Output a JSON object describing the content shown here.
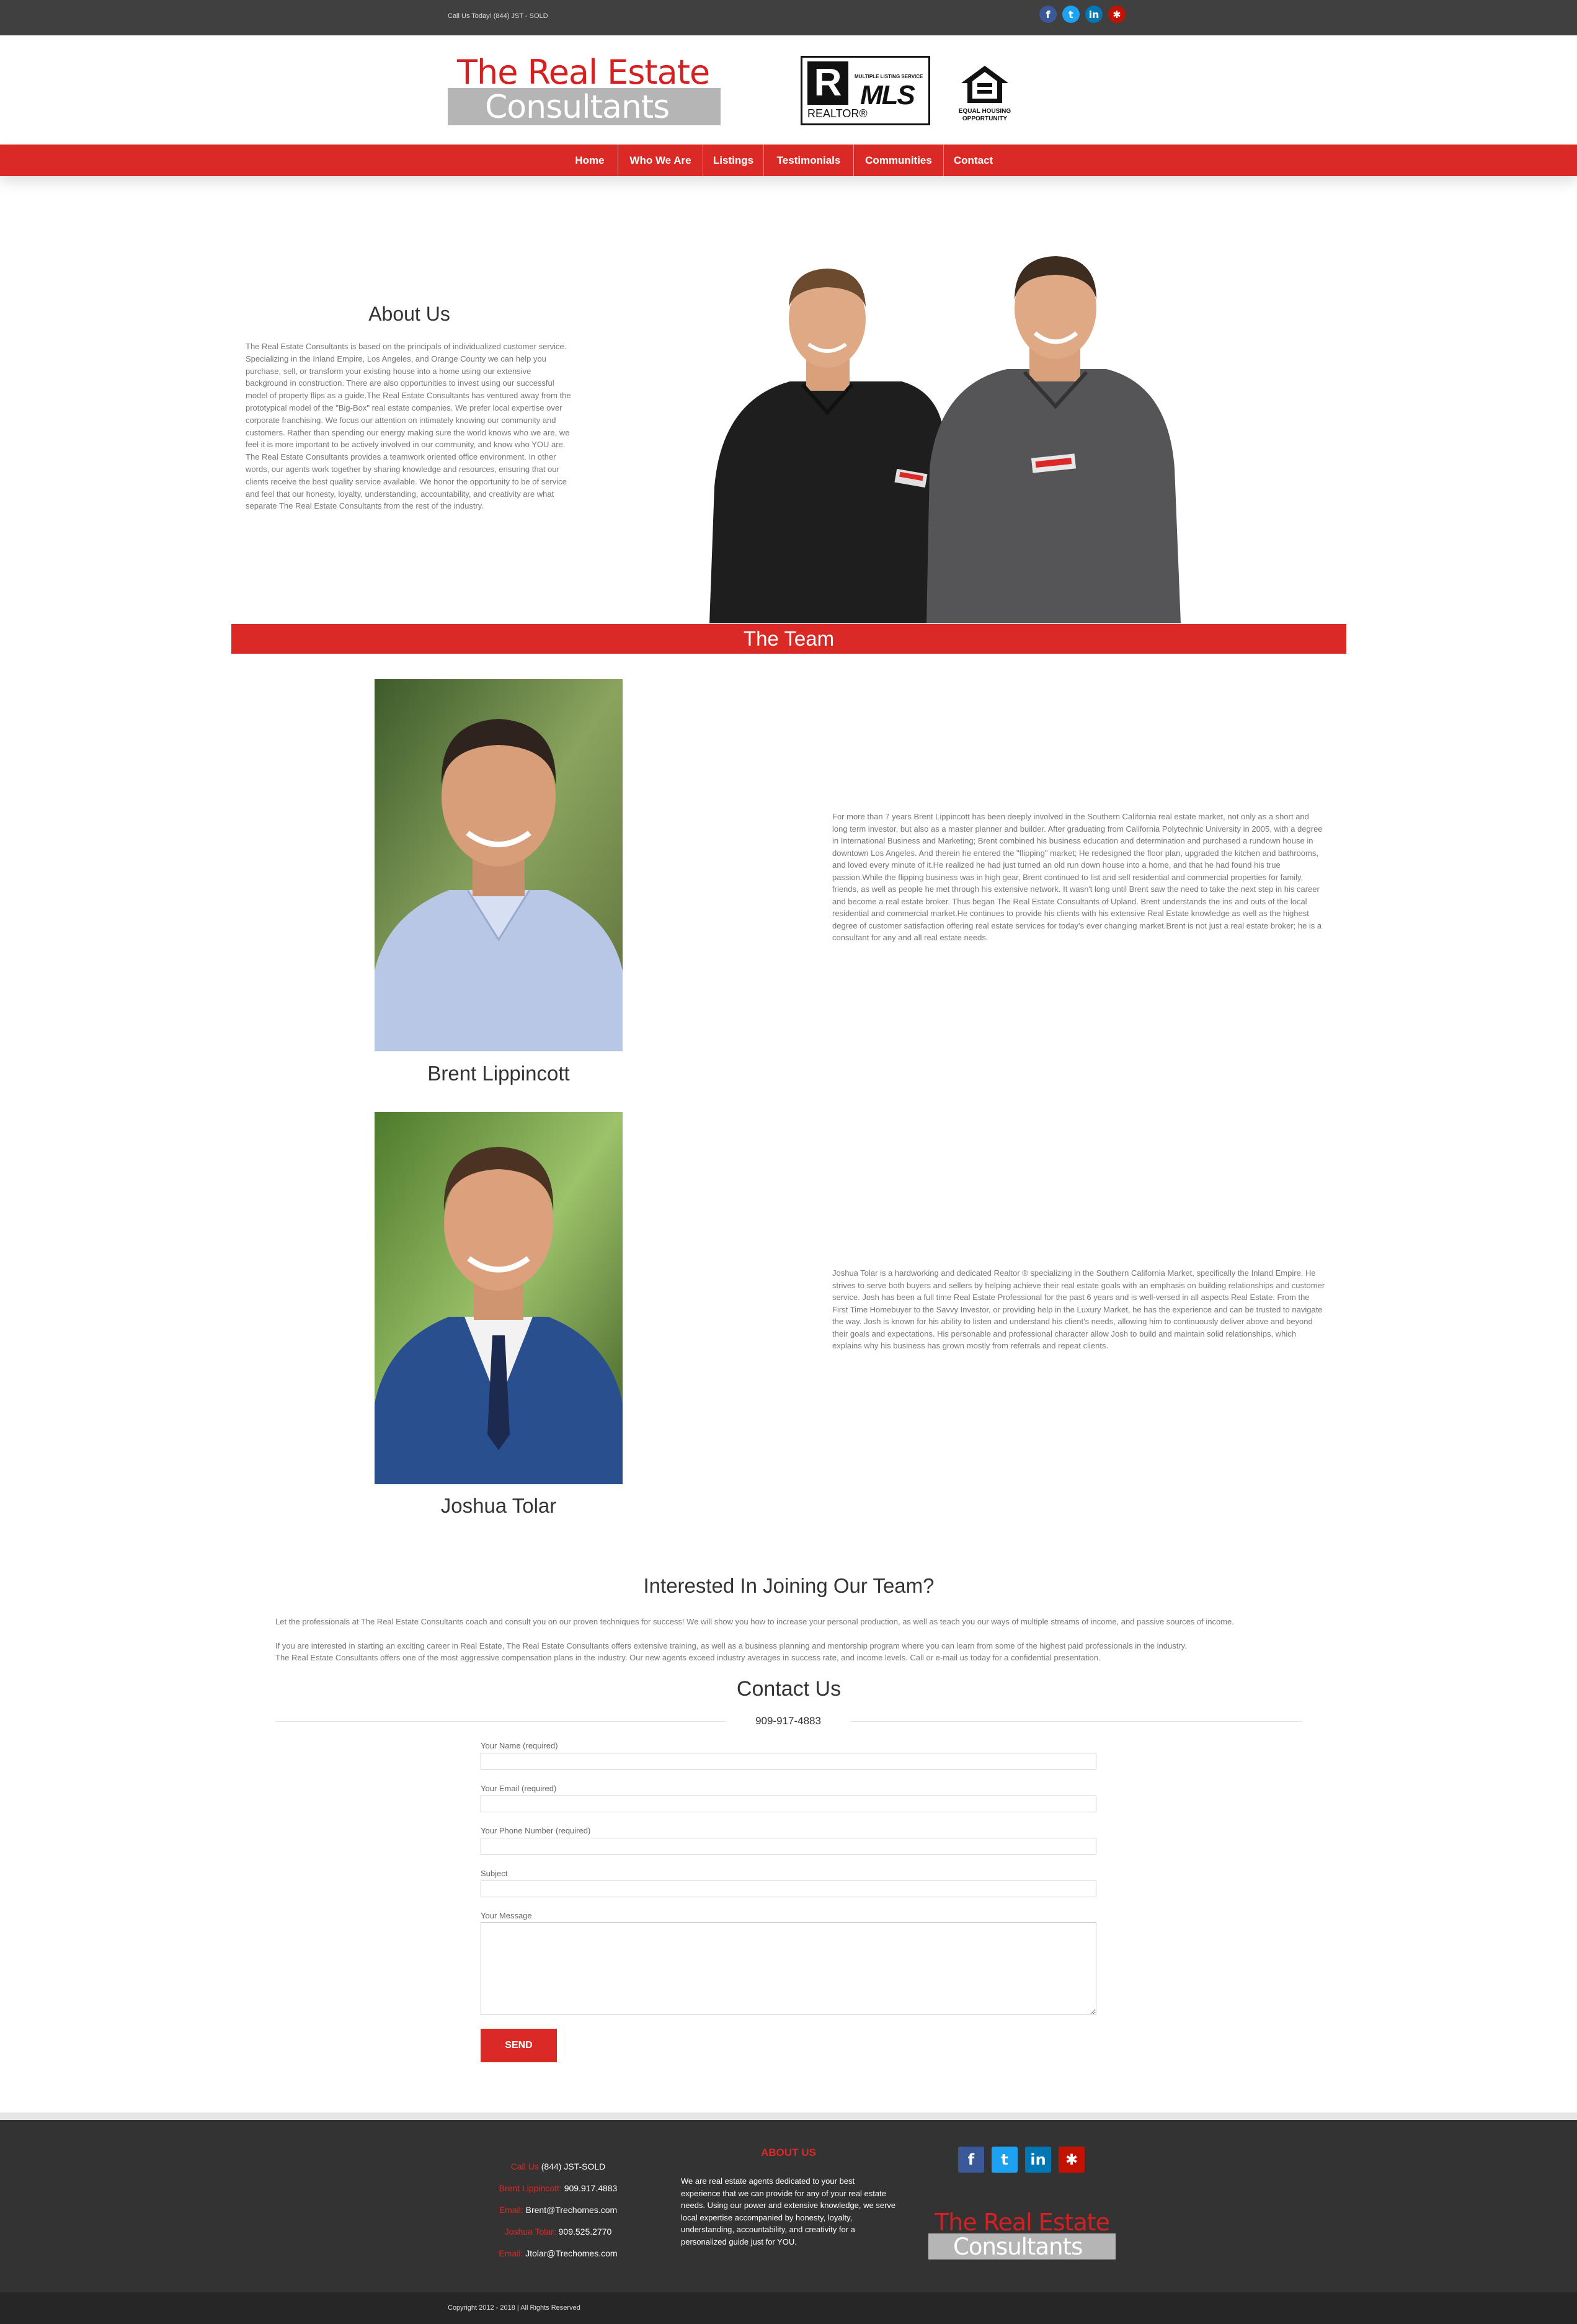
{
  "topbar": {
    "call_text": "Call Us Today! (844) JST - SOLD"
  },
  "social": [
    "facebook",
    "twitter",
    "linkedin",
    "yelp"
  ],
  "social_glyphs": {
    "facebook": "f",
    "twitter": "t",
    "linkedin": "in",
    "yelp": "✱"
  },
  "logo": {
    "line1": "The Real Estate",
    "line2": "Consultants"
  },
  "realtor_logo": {
    "letter": "R",
    "realtor": "REALTOR®",
    "mls_small": "MULTIPLE LISTING SERVICE",
    "mls": "MLS"
  },
  "eho_logo": {
    "line1": "EQUAL HOUSING",
    "line2": "OPPORTUNITY"
  },
  "nav": {
    "items": [
      {
        "label": "Home"
      },
      {
        "label": "Who We Are"
      },
      {
        "label": "Listings"
      },
      {
        "label": "Testimonials"
      },
      {
        "label": "Communities"
      },
      {
        "label": "Contact"
      }
    ]
  },
  "about": {
    "title": "About Us",
    "text": "The Real Estate Consultants is based on the principals of individualized customer service. Specializing in the Inland Empire, Los Angeles, and Orange County we can help you purchase, sell, or transform your existing house into a home using our extensive background in construction. There are also opportunities to invest using our successful model of property flips as a guide.The Real Estate Consultants has ventured away from the prototypical model of the \"Big-Box\" real estate companies. We prefer local expertise over corporate franchising. We focus our attention on intimately knowing our community and customers. Rather than spending our energy making sure the world knows who we are, we feel it is more important to be actively involved in our community, and know who YOU are. The Real Estate Consultants provides a teamwork oriented office environment. In other words, our agents work together by sharing knowledge and resources, ensuring that our clients receive the best quality service available. We honor the opportunity to be of service and feel that our honesty, loyalty, understanding, accountability, and creativity are what separate The Real Estate Consultants from the rest of the industry."
  },
  "team": {
    "banner": "The Team",
    "members": [
      {
        "name": "Brent Lippincott",
        "bio": "For more than 7 years Brent Lippincott has been deeply involved in the Southern California real estate market, not only as a short and long term investor, but also as a master planner and builder. After graduating from California Polytechnic University in 2005, with a degree in International Business and Marketing; Brent combined his business education and determination and purchased a rundown house in downtown Los Angeles. And therein he entered the \"flipping\" market; He redesigned the floor plan, upgraded the kitchen and bathrooms, and loved every minute of it.He realized he had just turned an old run down house into a home, and that he had found his true passion.While the flipping business was in high gear, Brent continued to list and sell residential and commercial properties for family, friends, as well as people he met through his extensive network. It wasn't long until Brent saw the need to take the next step in his career and become a real estate broker. Thus began The Real Estate Consultants of Upland. Brent understands the ins and outs of the local residential and commercial market.He continues to provide his clients with his extensive Real Estate knowledge as well as the highest degree of customer satisfaction offering real estate services for today's ever changing market.Brent is not just a real estate broker; he is a consultant for any and all real estate needs."
      },
      {
        "name": "Joshua Tolar",
        "bio": "Joshua Tolar is a hardworking and dedicated Realtor ® specializing in the Southern California Market, specifically the Inland Empire. He strives to serve both buyers and sellers by helping achieve their real estate goals with an emphasis on building relationships and customer service. Josh has been a full time Real Estate Professional for the past 6 years and is well-versed in all aspects Real Estate. From the First Time Homebuyer to the Savvy Investor, or providing help in the Luxury Market, he has the experience and can be trusted to navigate the way. Josh is known for his ability to listen and understand his client's needs, allowing him to continuously deliver above and beyond their goals and expectations. His personable and professional character allow Josh to build and maintain solid relationships, which explains why his business has grown mostly from referrals and repeat clients."
      }
    ]
  },
  "join": {
    "title": "Interested In Joining Our Team?",
    "p1": "Let the professionals at The Real Estate Consultants coach and consult you on our proven techniques for success! We will show you how to increase your personal production, as well as teach you our ways of multiple streams of income, and passive sources of income.",
    "p2": "If you are interested in starting an exciting career in Real Estate, The Real Estate Consultants offers extensive training, as well as a business planning and mentorship program where you can learn from some of the highest paid professionals in the industry.",
    "p3": "The Real Estate Consultants offers one of the most aggressive compensation plans in the industry. Our new agents exceed industry averages in success rate, and income levels. Call or e-mail us today for a confidential presentation."
  },
  "contact": {
    "title": "Contact Us",
    "phone": "909-917-4883",
    "fields": {
      "name_label": "Your Name (required)",
      "email_label": "Your Email (required)",
      "phone_label": "Your Phone Number (required)",
      "subject_label": "Subject",
      "message_label": "Your Message"
    },
    "send_label": "SEND"
  },
  "footer": {
    "call_label": "Call Us",
    "call_value": "(844) JST-SOLD",
    "brent_label": "Brent Lippincott:",
    "brent_phone": "909.917.4883",
    "email_label": "Email:",
    "brent_email": "Brent@Trechomes.com",
    "joshua_label": "Joshua Tolar:",
    "joshua_phone": "909.525.2770",
    "joshua_email": "Jtolar@Trechomes.com",
    "about_title": "ABOUT US",
    "about_text": "We are real estate agents dedicated to your best experience that we can provide for any of your real estate needs. Using our power and extensive knowledge, we serve local expertise accompanied by honesty, loyalty, understanding, accountability, and creativity for a personalized guide just for YOU.",
    "copyright": "Copyright 2012 - 2018 | All Rights Reserved"
  },
  "colors": {
    "brand_red": "#db2a25",
    "topbar": "#404040",
    "footer": "#333333",
    "copybar": "#262626",
    "facebook": "#3b5998",
    "twitter": "#1da1f2",
    "linkedin": "#0077b5",
    "yelp": "#c41200"
  }
}
